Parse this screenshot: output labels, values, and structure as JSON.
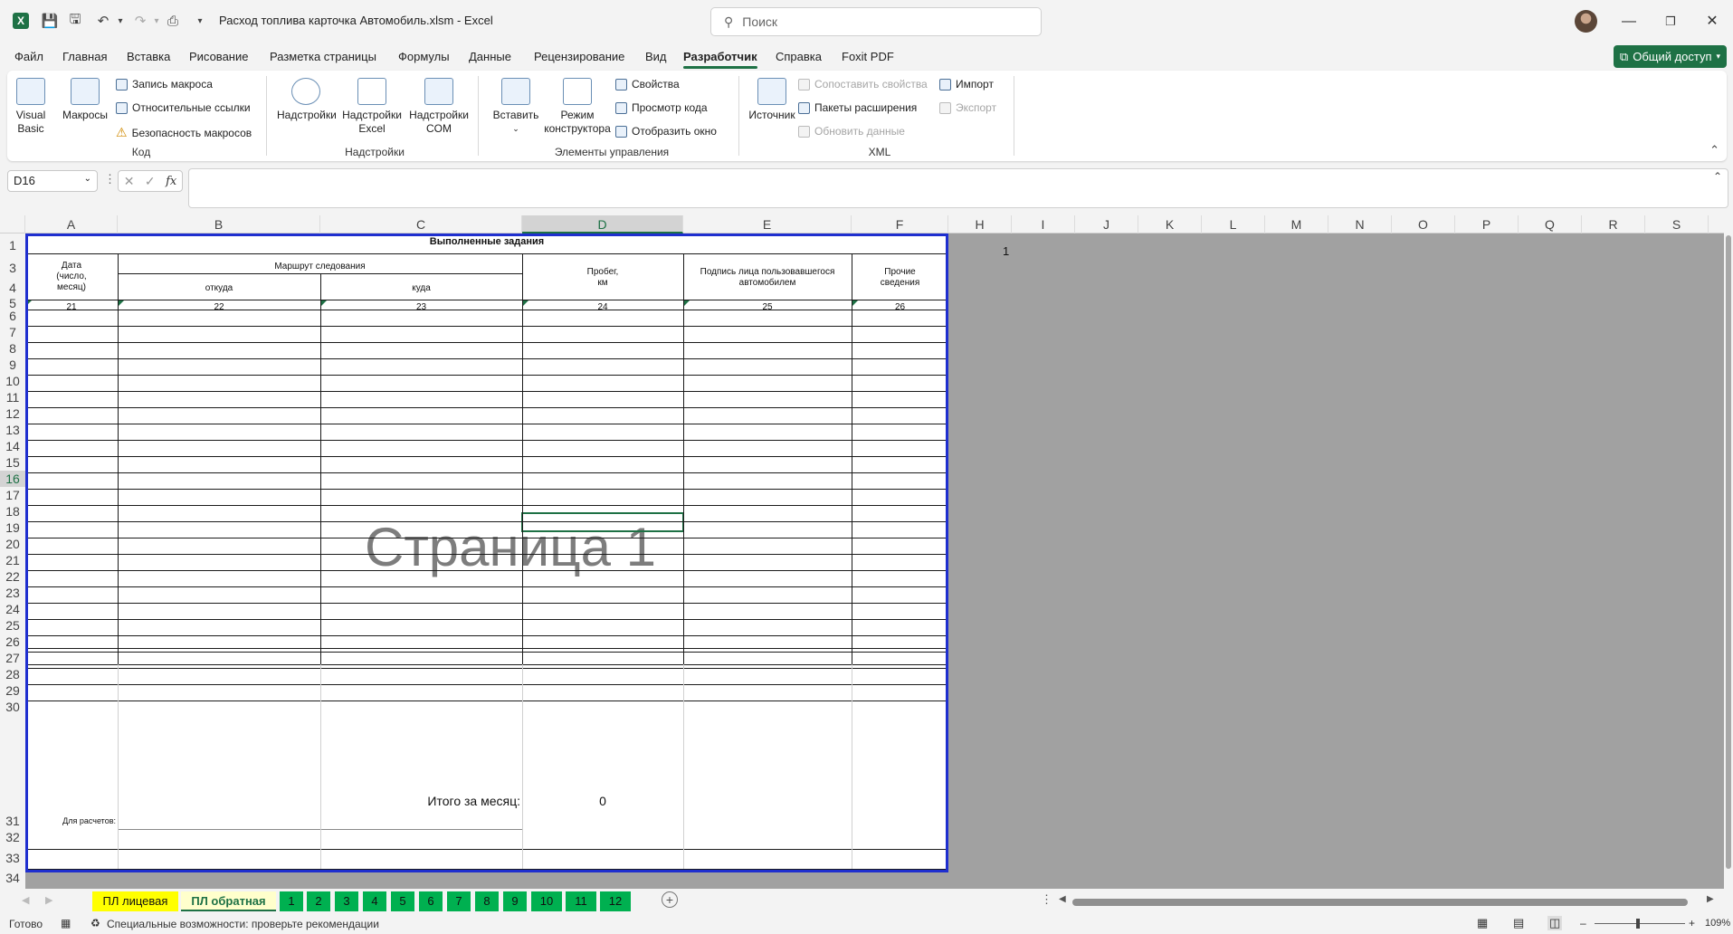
{
  "app": {
    "doc_title": "Расход топлива карточка Автомобиль.xlsm  -  Excel",
    "search_placeholder": "Поиск",
    "share_label": "Общий доступ"
  },
  "menu": [
    "Файл",
    "Главная",
    "Вставка",
    "Рисование",
    "Разметка страницы",
    "Формулы",
    "Данные",
    "Рецензирование",
    "Вид",
    "Разработчик",
    "Справка",
    "Foxit PDF"
  ],
  "ribbon": {
    "code": {
      "visual_basic": "Visual\nBasic",
      "macros": "Макросы",
      "record": "Запись макроса",
      "relative": "Относительные ссылки",
      "security": "Безопасность макросов",
      "label": "Код"
    },
    "addins": {
      "addins": "Надстройки",
      "excel": "Надстройки\nExcel",
      "com": "Надстройки\nCOM",
      "label": "Надстройки"
    },
    "controls": {
      "insert": "Вставить",
      "design": "Режим\nконструктора",
      "properties": "Свойства",
      "view_code": "Просмотр кода",
      "dialog": "Отобразить окно",
      "label": "Элементы управления"
    },
    "xml": {
      "source": "Источник",
      "map_props": "Сопоставить свойства",
      "packs": "Пакеты расширения",
      "refresh": "Обновить данные",
      "import": "Импорт",
      "export": "Экспорт",
      "label": "XML"
    }
  },
  "namebox": "D16",
  "columns": [
    "A",
    "B",
    "C",
    "D",
    "E",
    "F",
    "H",
    "I",
    "J",
    "K",
    "L",
    "M",
    "N",
    "O",
    "P",
    "Q",
    "R",
    "S"
  ],
  "rows": [
    "1",
    "3",
    "4",
    "5",
    "6",
    "7",
    "8",
    "9",
    "10",
    "11",
    "12",
    "13",
    "14",
    "15",
    "16",
    "17",
    "18",
    "19",
    "20",
    "21",
    "22",
    "23",
    "24",
    "25",
    "26",
    "27",
    "28",
    "29",
    "30",
    "31",
    "32",
    "33",
    "34"
  ],
  "sheet": {
    "title": "Выполненные задания",
    "h_date": "Дата\n(число,\nмесяц)",
    "h_route": "Маршрут следования",
    "h_from": "откуда",
    "h_to": "куда",
    "h_km": "Пробег,\nкм",
    "h_sign": "Подпись лица пользовавшегося\nавтомобилем",
    "h_other": "Прочие\nсведения",
    "nums": [
      "21",
      "22",
      "23",
      "24",
      "25",
      "26"
    ],
    "total_label": "Итого за месяц:",
    "total_value": "0",
    "calc_label": "Для расчетов:",
    "watermark": "Страница 1",
    "page_number": "1"
  },
  "sheet_tabs": [
    "ПЛ лицевая",
    "ПЛ обратная",
    "1",
    "2",
    "3",
    "4",
    "5",
    "6",
    "7",
    "8",
    "9",
    "10",
    "11",
    "12"
  ],
  "status": {
    "ready": "Готово",
    "accessibility": "Специальные возможности: проверьте рекомендации",
    "zoom": "109%"
  },
  "colors": {
    "excel_green": "#1e7145",
    "tab_yellow": "#ffff00",
    "tab_green": "#00b050",
    "selected_tab_bg": "#ffffcc",
    "page_border": "#1f2fcf"
  }
}
